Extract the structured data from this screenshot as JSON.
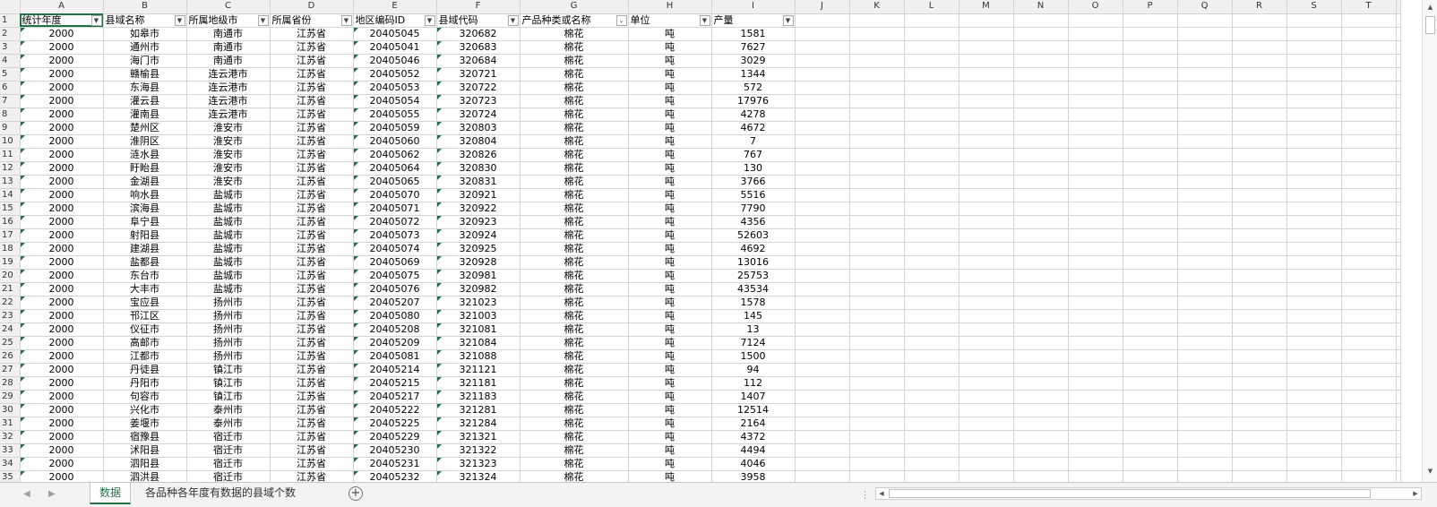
{
  "columns": [
    "A",
    "B",
    "C",
    "D",
    "E",
    "F",
    "G",
    "H",
    "I",
    "J",
    "K",
    "L",
    "M",
    "N",
    "O",
    "P",
    "Q",
    "R",
    "S",
    "T"
  ],
  "headers": [
    "统计年度",
    "县域名称",
    "所属地级市",
    "所属省份",
    "地区编码ID",
    "县域代码",
    "产品种类或名称",
    "单位",
    "产量"
  ],
  "row_numbers": [
    "1",
    "2",
    "3",
    "4",
    "5",
    "6",
    "7",
    "8",
    "9",
    "10",
    "11",
    "12",
    "13",
    "14",
    "15",
    "16",
    "17",
    "18",
    "19",
    "20",
    "21",
    "22",
    "23",
    "24",
    "25",
    "26",
    "27",
    "28",
    "29",
    "30",
    "31",
    "32",
    "33",
    "34",
    "35"
  ],
  "rows": [
    [
      "2000",
      "如皋市",
      "南通市",
      "江苏省",
      "20405045",
      "320682",
      "棉花",
      "吨",
      "1581"
    ],
    [
      "2000",
      "通州市",
      "南通市",
      "江苏省",
      "20405041",
      "320683",
      "棉花",
      "吨",
      "7627"
    ],
    [
      "2000",
      "海门市",
      "南通市",
      "江苏省",
      "20405046",
      "320684",
      "棉花",
      "吨",
      "3029"
    ],
    [
      "2000",
      "赣榆县",
      "连云港市",
      "江苏省",
      "20405052",
      "320721",
      "棉花",
      "吨",
      "1344"
    ],
    [
      "2000",
      "东海县",
      "连云港市",
      "江苏省",
      "20405053",
      "320722",
      "棉花",
      "吨",
      "572"
    ],
    [
      "2000",
      "灌云县",
      "连云港市",
      "江苏省",
      "20405054",
      "320723",
      "棉花",
      "吨",
      "17976"
    ],
    [
      "2000",
      "灌南县",
      "连云港市",
      "江苏省",
      "20405055",
      "320724",
      "棉花",
      "吨",
      "4278"
    ],
    [
      "2000",
      "楚州区",
      "淮安市",
      "江苏省",
      "20405059",
      "320803",
      "棉花",
      "吨",
      "4672"
    ],
    [
      "2000",
      "淮阴区",
      "淮安市",
      "江苏省",
      "20405060",
      "320804",
      "棉花",
      "吨",
      "7"
    ],
    [
      "2000",
      "涟水县",
      "淮安市",
      "江苏省",
      "20405062",
      "320826",
      "棉花",
      "吨",
      "767"
    ],
    [
      "2000",
      "盱眙县",
      "淮安市",
      "江苏省",
      "20405064",
      "320830",
      "棉花",
      "吨",
      "130"
    ],
    [
      "2000",
      "金湖县",
      "淮安市",
      "江苏省",
      "20405065",
      "320831",
      "棉花",
      "吨",
      "3766"
    ],
    [
      "2000",
      "响水县",
      "盐城市",
      "江苏省",
      "20405070",
      "320921",
      "棉花",
      "吨",
      "5516"
    ],
    [
      "2000",
      "滨海县",
      "盐城市",
      "江苏省",
      "20405071",
      "320922",
      "棉花",
      "吨",
      "7790"
    ],
    [
      "2000",
      "阜宁县",
      "盐城市",
      "江苏省",
      "20405072",
      "320923",
      "棉花",
      "吨",
      "4356"
    ],
    [
      "2000",
      "射阳县",
      "盐城市",
      "江苏省",
      "20405073",
      "320924",
      "棉花",
      "吨",
      "52603"
    ],
    [
      "2000",
      "建湖县",
      "盐城市",
      "江苏省",
      "20405074",
      "320925",
      "棉花",
      "吨",
      "4692"
    ],
    [
      "2000",
      "盐都县",
      "盐城市",
      "江苏省",
      "20405069",
      "320928",
      "棉花",
      "吨",
      "13016"
    ],
    [
      "2000",
      "东台市",
      "盐城市",
      "江苏省",
      "20405075",
      "320981",
      "棉花",
      "吨",
      "25753"
    ],
    [
      "2000",
      "大丰市",
      "盐城市",
      "江苏省",
      "20405076",
      "320982",
      "棉花",
      "吨",
      "43534"
    ],
    [
      "2000",
      "宝应县",
      "扬州市",
      "江苏省",
      "20405207",
      "321023",
      "棉花",
      "吨",
      "1578"
    ],
    [
      "2000",
      "邗江区",
      "扬州市",
      "江苏省",
      "20405080",
      "321003",
      "棉花",
      "吨",
      "145"
    ],
    [
      "2000",
      "仪征市",
      "扬州市",
      "江苏省",
      "20405208",
      "321081",
      "棉花",
      "吨",
      "13"
    ],
    [
      "2000",
      "高邮市",
      "扬州市",
      "江苏省",
      "20405209",
      "321084",
      "棉花",
      "吨",
      "7124"
    ],
    [
      "2000",
      "江都市",
      "扬州市",
      "江苏省",
      "20405081",
      "321088",
      "棉花",
      "吨",
      "1500"
    ],
    [
      "2000",
      "丹徒县",
      "镇江市",
      "江苏省",
      "20405214",
      "321121",
      "棉花",
      "吨",
      "94"
    ],
    [
      "2000",
      "丹阳市",
      "镇江市",
      "江苏省",
      "20405215",
      "321181",
      "棉花",
      "吨",
      "112"
    ],
    [
      "2000",
      "句容市",
      "镇江市",
      "江苏省",
      "20405217",
      "321183",
      "棉花",
      "吨",
      "1407"
    ],
    [
      "2000",
      "兴化市",
      "泰州市",
      "江苏省",
      "20405222",
      "321281",
      "棉花",
      "吨",
      "12514"
    ],
    [
      "2000",
      "姜堰市",
      "泰州市",
      "江苏省",
      "20405225",
      "321284",
      "棉花",
      "吨",
      "2164"
    ],
    [
      "2000",
      "宿豫县",
      "宿迁市",
      "江苏省",
      "20405229",
      "321321",
      "棉花",
      "吨",
      "4372"
    ],
    [
      "2000",
      "沭阳县",
      "宿迁市",
      "江苏省",
      "20405230",
      "321322",
      "棉花",
      "吨",
      "4494"
    ],
    [
      "2000",
      "泗阳县",
      "宿迁市",
      "江苏省",
      "20405231",
      "321323",
      "棉花",
      "吨",
      "4046"
    ],
    [
      "2000",
      "泗洪县",
      "宿迁市",
      "江苏省",
      "20405232",
      "321324",
      "棉花",
      "吨",
      "3958"
    ]
  ],
  "tabs": {
    "active": "数据",
    "other": "各品种各年度有数据的县域个数",
    "add_label": "+"
  },
  "glyphs": {
    "filter": "▼",
    "sort_filter": "⌄",
    "left": "◀",
    "right": "▶",
    "up": "▲",
    "down": "▼",
    "more": "⋮"
  },
  "colors": {
    "accent": "#217346",
    "indicator": "#1e7145"
  }
}
